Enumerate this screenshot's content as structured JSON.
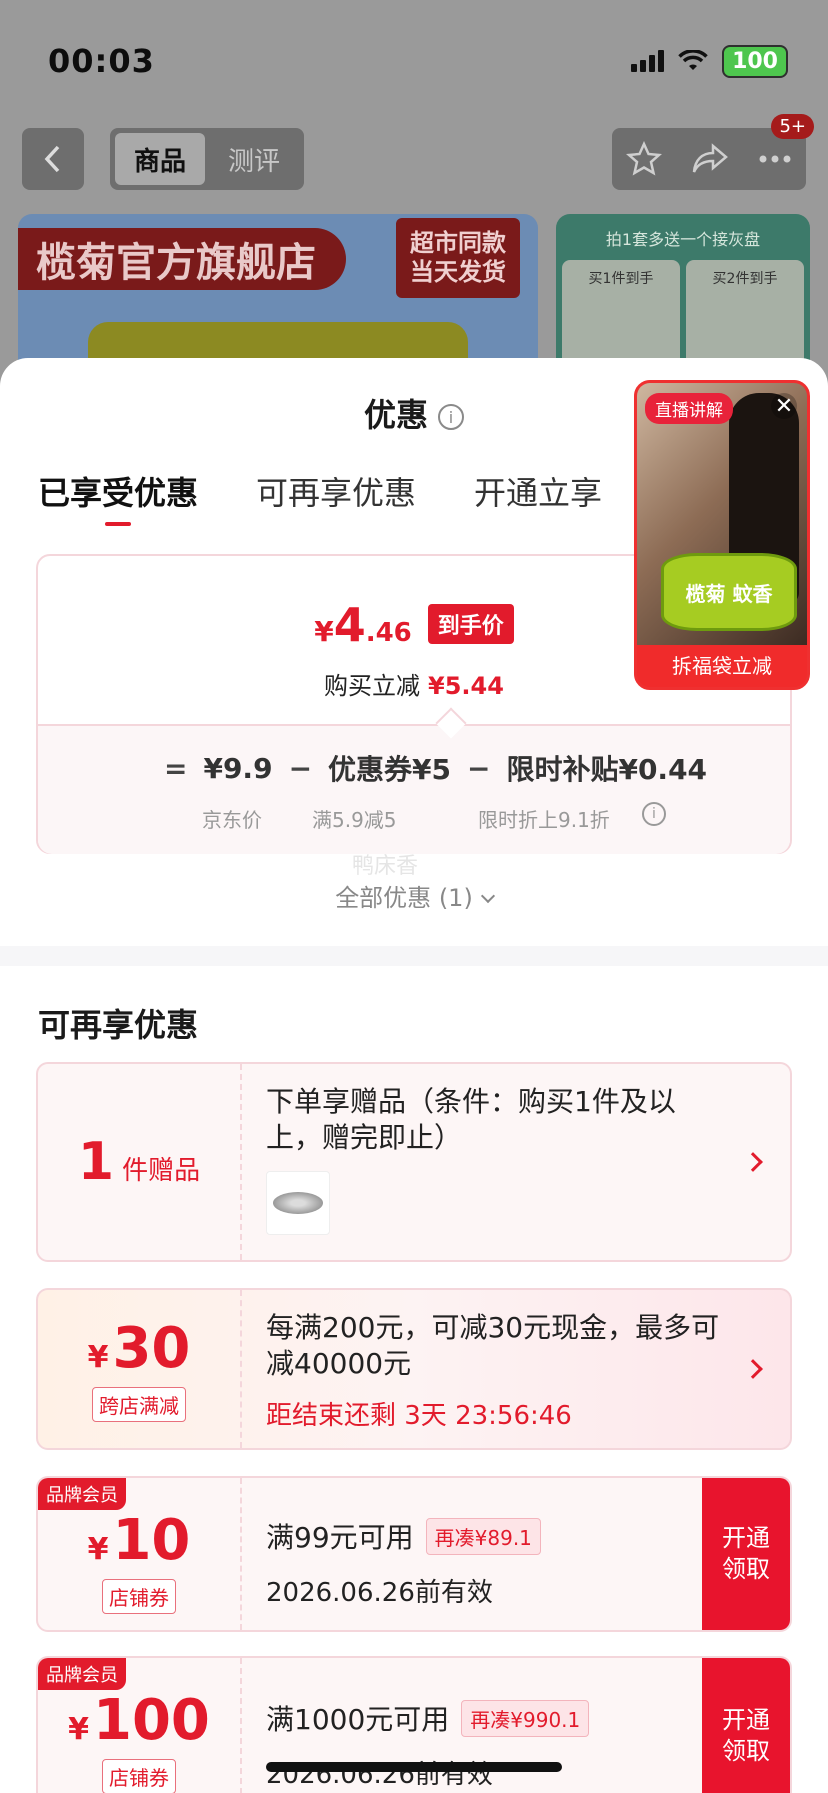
{
  "status_bar": {
    "time": "00:03",
    "battery": "100"
  },
  "nav": {
    "tabs": [
      "商品",
      "测评"
    ],
    "badge": "5+"
  },
  "banner": {
    "store_name": "榄菊官方旗舰店",
    "tag_line1": "超市同款",
    "tag_line2": "当天发货",
    "side_title": "拍1套多送一个接灰盘",
    "side_card1": "买1件到手",
    "side_card2": "买2件到手"
  },
  "sheet": {
    "title": "优惠",
    "info_glyph": "i",
    "tabs": [
      "已享受优惠",
      "可再享优惠",
      "开通立享"
    ]
  },
  "live": {
    "tag": "直播讲解",
    "close": "✕",
    "can_text": "榄菊  蚊香",
    "caption": "拆福袋立减"
  },
  "price": {
    "currency": "¥",
    "int": "4",
    "dec": ".46",
    "tag": "到手价",
    "save_label": "购买立减",
    "save_value": "¥5.44",
    "eq": "=",
    "jd_price": "¥9.9",
    "minus": "−",
    "coupon": "优惠券¥5",
    "subsidy": "限时补贴¥0.44",
    "jd_label": "京东价",
    "coupon_label": "满5.9减5",
    "subsidy_label": "限时折上9.1折"
  },
  "watermark": "鸭床香",
  "all_offers": "全部优惠 (1)",
  "section_title": "可再享优惠",
  "gift_offer": {
    "num": "1",
    "unit": "件赠品",
    "text": "下单享赠品（条件：购买1件及以上，赠完即止）"
  },
  "cross_store": {
    "currency": "¥",
    "amount": "30",
    "tag": "跨店满减",
    "text": "每满200元，可减30元现金，最多可减40000元",
    "countdown": "距结束还剩 3天 23:56:46"
  },
  "coupons": [
    {
      "badge": "品牌会员",
      "currency": "¥",
      "amount": "10",
      "tag": "店铺券",
      "condition": "满99元可用",
      "gap": "再凑¥89.1",
      "expire": "2026.06.26前有效",
      "button": "开通\n领取"
    },
    {
      "badge": "品牌会员",
      "currency": "¥",
      "amount": "100",
      "tag": "店铺券",
      "condition": "满1000元可用",
      "gap": "再凑¥990.1",
      "expire": "2026.06.26前有效",
      "button": "开通\n领取"
    }
  ],
  "colors": {
    "accent": "#e21b2c",
    "sheet_bg": "#ffffff",
    "battery": "#4ec64e"
  }
}
